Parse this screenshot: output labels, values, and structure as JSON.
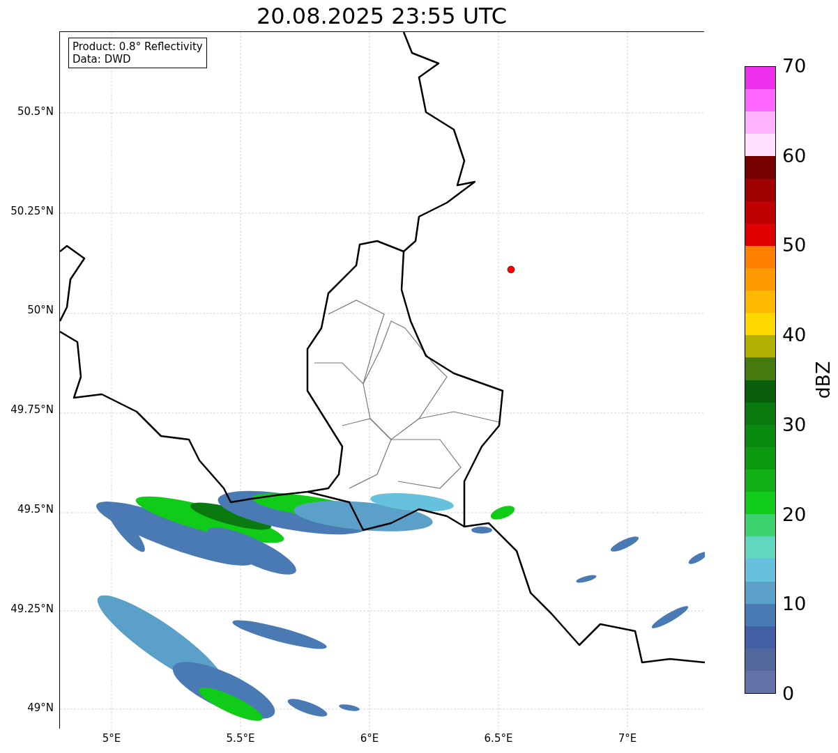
{
  "title": "20.08.2025 23:55 UTC",
  "legend": [
    "Product: 0.8° Reflectivity",
    "Data: DWD"
  ],
  "y_ticks": [
    "50.5°N",
    "50.25°N",
    "50°N",
    "49.75°N",
    "49.5°N",
    "49.25°N",
    "49°N"
  ],
  "x_ticks": [
    "5°E",
    "5.5°E",
    "6°E",
    "6.5°E",
    "7°E"
  ],
  "colorbar": {
    "label": "dBZ",
    "ticks": [
      "70",
      "60",
      "50",
      "40",
      "30",
      "20",
      "10",
      "0"
    ],
    "segments": [
      {
        "color": "#ee30ee"
      },
      {
        "color": "#ff66ff"
      },
      {
        "color": "#ffb3ff"
      },
      {
        "color": "#ffe0ff"
      },
      {
        "color": "#780000"
      },
      {
        "color": "#a00000"
      },
      {
        "color": "#c00000"
      },
      {
        "color": "#e00000"
      },
      {
        "color": "#ff7f00"
      },
      {
        "color": "#ff9900"
      },
      {
        "color": "#ffb800"
      },
      {
        "color": "#ffd800"
      },
      {
        "color": "#b0b000"
      },
      {
        "color": "#457a10"
      },
      {
        "color": "#0a5f0a"
      },
      {
        "color": "#0a7a10"
      },
      {
        "color": "#0a8a10"
      },
      {
        "color": "#0c9a10"
      },
      {
        "color": "#10b016"
      },
      {
        "color": "#10cc18"
      },
      {
        "color": "#3cd46c"
      },
      {
        "color": "#60d8c0"
      },
      {
        "color": "#66c2dc"
      },
      {
        "color": "#5aa0c8"
      },
      {
        "color": "#4a7ab4"
      },
      {
        "color": "#4460a4"
      },
      {
        "color": "#5468a0"
      },
      {
        "color": "#6474a8"
      }
    ]
  }
}
